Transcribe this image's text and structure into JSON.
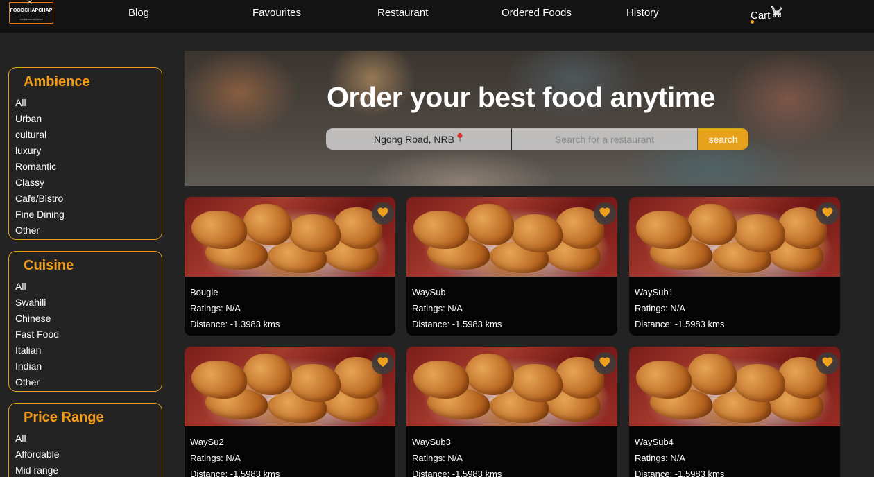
{
  "brand": {
    "name": "FOODCHAPCHAP",
    "tagline": "YOUR FOOD IN A SNAP"
  },
  "nav": {
    "links": [
      "Blog",
      "Favourites",
      "Restaurant",
      "Ordered Foods",
      "History"
    ],
    "cart_label": "Cart"
  },
  "sidebar": {
    "ambience": {
      "title": "Ambience",
      "items": [
        "All",
        "Urban",
        "cultural",
        "luxury",
        "Romantic",
        "Classy",
        "Cafe/Bistro",
        "Fine Dining",
        "Other"
      ]
    },
    "cuisine": {
      "title": "Cuisine",
      "items": [
        "All",
        "Swahili",
        "Chinese",
        "Fast Food",
        "Italian",
        "Indian",
        "Other"
      ]
    },
    "price": {
      "title": "Price Range",
      "items": [
        "All",
        "Affordable",
        "Mid range"
      ]
    }
  },
  "hero": {
    "title": "Order your best food anytime",
    "location": "Ngong Road, NRB",
    "search_placeholder": "Search for a restaurant",
    "search_button": "search"
  },
  "restaurants": [
    {
      "name": "Bougie",
      "ratings": "Ratings: N/A",
      "distance": "Distance: -1.3983 kms"
    },
    {
      "name": "WaySub",
      "ratings": "Ratings: N/A",
      "distance": "Distance: -1.5983 kms"
    },
    {
      "name": "WaySub1",
      "ratings": "Ratings: N/A",
      "distance": "Distance: -1.5983 kms"
    },
    {
      "name": "WaySu2",
      "ratings": "Ratings: N/A",
      "distance": "Distance: -1.5983 kms"
    },
    {
      "name": "WaySub3",
      "ratings": "Ratings: N/A",
      "distance": "Distance: -1.5983 kms"
    },
    {
      "name": "WaySub4",
      "ratings": "Ratings: N/A",
      "distance": "Distance: -1.5983 kms"
    }
  ],
  "colors": {
    "accent": "#f49b18",
    "button": "#e7a21d",
    "heart": "#f0a020",
    "background": "#232323",
    "topbar": "#131313"
  },
  "icons": {
    "cart": "cart-icon",
    "favourite": "heart-icon",
    "location": "pin-icon",
    "logo": "fork-knife-icon"
  }
}
